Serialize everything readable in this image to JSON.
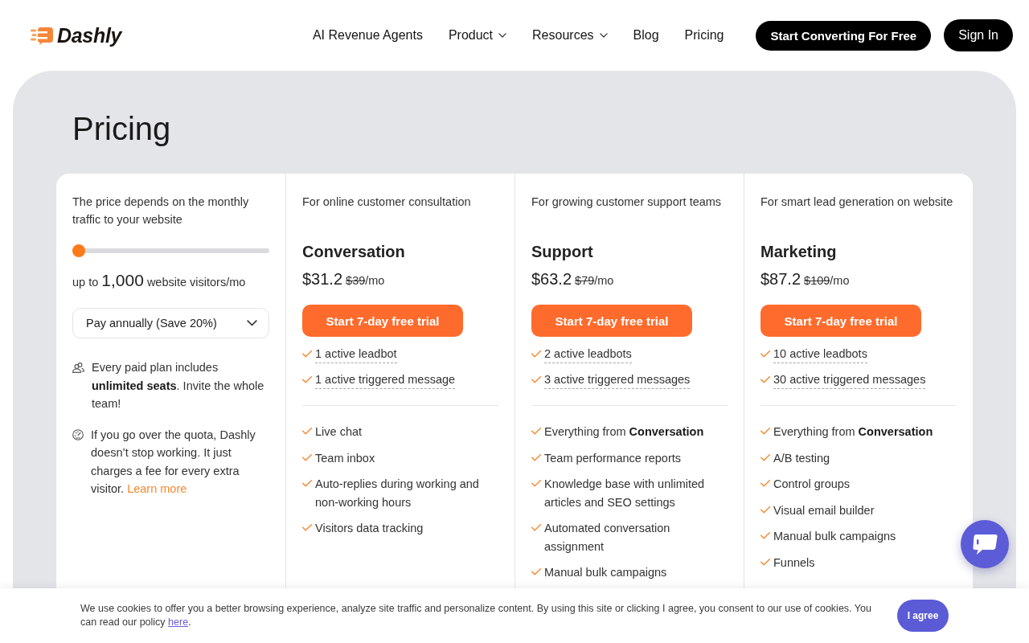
{
  "header": {
    "logo": "Dashly",
    "nav": [
      {
        "label": "AI Revenue Agents",
        "dropdown": false
      },
      {
        "label": "Product",
        "dropdown": true
      },
      {
        "label": "Resources",
        "dropdown": true
      },
      {
        "label": "Blog",
        "dropdown": false
      },
      {
        "label": "Pricing",
        "dropdown": false
      }
    ],
    "buttons": [
      {
        "label": "Start Converting For Free",
        "kind": "primary"
      },
      {
        "label": "Sign In",
        "kind": "secondary"
      }
    ]
  },
  "page_title": "Pricing",
  "traffic": {
    "description": "The price depends on the monthly traffic to your website",
    "slider": {
      "level": 0
    },
    "visitors": {
      "prefix": "up to",
      "count": "1,000",
      "suffix": "website visitors/mo"
    },
    "billing_select": {
      "value": "Pay annually (Save 20%)"
    },
    "notes": [
      {
        "kind": "seats",
        "text": "Every paid plan includes **unlimited seats**. Invite the whole team!"
      },
      {
        "kind": "quota",
        "text": "If you go over the quota, Dashly doesn’t stop working. It just charges a fee for every extra visitor.",
        "link": "Learn more"
      }
    ]
  },
  "plans": [
    {
      "tagline": "For online customer consultation",
      "name": "Conversation",
      "price": "$31.2",
      "old_price": "$39",
      "period": "/mo",
      "button": "Start 7-day free trial",
      "limits": [
        "1 active leadbot",
        "1 active triggered message"
      ],
      "features": [
        "Live chat",
        "Team inbox",
        "Auto-replies during working and non-working hours",
        "Visitors data tracking"
      ]
    },
    {
      "tagline": "For growing customer support teams",
      "name": "Support",
      "price": "$63.2",
      "old_price": "$79",
      "period": "/mo",
      "button": "Start 7-day free trial",
      "limits": [
        "2 active leadbots",
        "3 active triggered messages"
      ],
      "features": [
        "Everything from **Conversation**",
        "Team performance reports",
        "Knowledge base with unlimited articles and SEO settings",
        "Automated conversation assignment",
        "Manual bulk campaigns"
      ]
    },
    {
      "tagline": "For smart lead generation on website",
      "name": "Marketing",
      "price": "$87.2",
      "old_price": "$109",
      "period": "/mo",
      "button": "Start 7-day free trial",
      "limits": [
        "10 active leadbots",
        "30 active triggered messages"
      ],
      "features": [
        "Everything from **Conversation**",
        "A/B testing",
        "Control groups",
        "Visual email builder",
        "Manual bulk campaigns",
        "Funnels"
      ]
    }
  ],
  "cookie_banner": {
    "text": "We use cookies to offer you a better browsing experience, analyze site traffic and personalize content. By using this site or clicking I agree, you consent to our use of cookies. You can read our policy",
    "link": "here",
    "after_link": ".",
    "button": "I agree"
  }
}
